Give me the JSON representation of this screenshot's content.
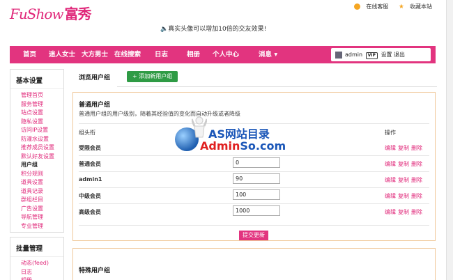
{
  "header": {
    "logo_en": "FuShow",
    "logo_cn": "富秀",
    "service": "在线客服",
    "favorite": "收藏本站",
    "slogan": "真实头像可以增加10倍的交友效果!"
  },
  "nav": {
    "items": [
      "首页",
      "迷人女士",
      "大方男士",
      "在线搜索",
      "日志",
      "相册",
      "个人中心",
      "消息"
    ],
    "username": "admin",
    "vip": "VIP",
    "settings": "设置",
    "logout": "退出"
  },
  "sidebar": {
    "basic_title": "基本设置",
    "basic_items": [
      "管理首页",
      "服务管理",
      "站点设置",
      "隐私设置",
      "访问IP设置",
      "防灌水设置",
      "推荐成员设置",
      "默认好友设置",
      "用户组",
      "积分规则",
      "道具设置",
      "道具记录",
      "群组栏目",
      "广告设置",
      "导航管理",
      "专业管理"
    ],
    "active_item": "用户组",
    "bulk_title": "批量管理",
    "bulk_items": [
      "动态(feed)",
      "日志",
      "相册"
    ]
  },
  "tabs": {
    "current": "浏览用户组",
    "add": "+ 添加新用户组"
  },
  "panel": {
    "title": "普通用户组",
    "desc": "普通用户组的用户级别，随着其经验值的变化而自动升级或者降级",
    "col_name": "组头衔",
    "col_ops": "操作",
    "rows": [
      {
        "name": "受限会员",
        "value": ""
      },
      {
        "name": "普通会员",
        "value": "0"
      },
      {
        "name": "admin1",
        "value": "90"
      },
      {
        "name": "中级会员",
        "value": "100"
      },
      {
        "name": "高级会员",
        "value": "1000"
      }
    ],
    "op_edit": "编辑",
    "op_copy": "复制",
    "op_delete": "删除",
    "submit": "提交更新"
  },
  "panel2": {
    "title": "特殊用户组"
  },
  "watermark": {
    "text1": "AS网站目录",
    "text2a": "Admin",
    "text2b": "So.com"
  }
}
